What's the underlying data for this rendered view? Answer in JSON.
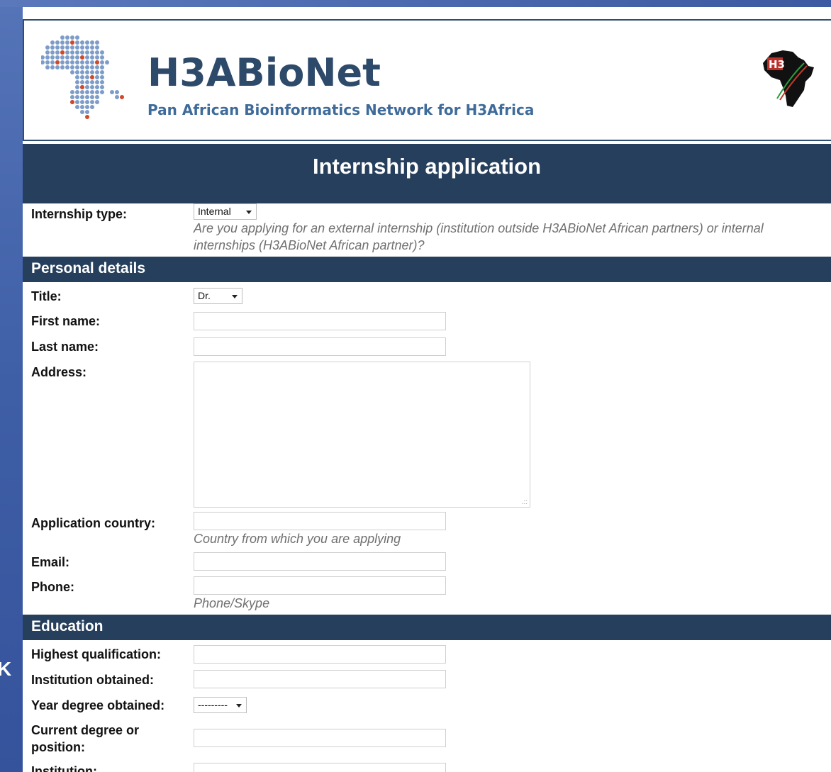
{
  "header": {
    "brand_title": "H3ABioNet",
    "brand_subtitle": "Pan African Bioinformatics Network for H3Africa",
    "africa_logo_text": "H3"
  },
  "page_title": "Internship application",
  "internship": {
    "label": "Internship type:",
    "selected": "Internal",
    "help": "Are you applying for an external internship (institution outside H3ABioNet African partners) or internal internships (H3ABioNet African partner)?"
  },
  "personal": {
    "section_title": "Personal details",
    "title_label": "Title:",
    "title_selected": "Dr.",
    "first_name_label": "First name:",
    "last_name_label": "Last name:",
    "address_label": "Address:",
    "country_label": "Application country:",
    "country_help": "Country from which you are applying",
    "email_label": "Email:",
    "phone_label": "Phone:",
    "phone_help": "Phone/Skype"
  },
  "education": {
    "section_title": "Education",
    "highest_label": "Highest qualification:",
    "institution_obtained_label": "Institution obtained:",
    "year_label": "Year degree obtained:",
    "year_selected": "---------",
    "current_label_line1": "Current degree or",
    "current_label_line2": "position:",
    "institution_label": "Institution:"
  },
  "side_glyph": "K",
  "colors": {
    "navy_bar": "#263f5c",
    "brand_text": "#2d4a6b",
    "background_blue": "#4d6fb3"
  }
}
